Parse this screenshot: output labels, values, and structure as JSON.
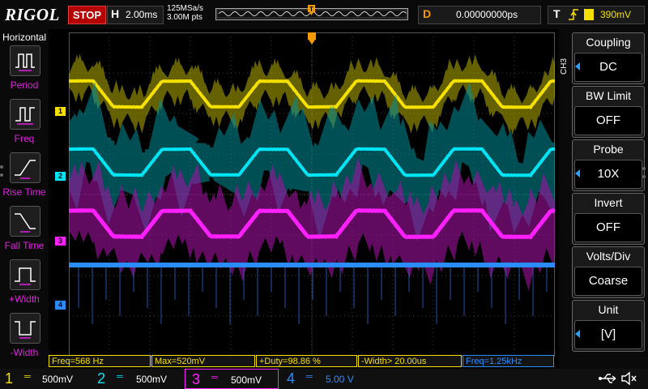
{
  "header": {
    "logo": "RIGOL",
    "run_state": "STOP",
    "h_letter": "H",
    "timebase": "2.00ms",
    "sample_rate": "125MSa/s",
    "memory_depth": "3.00M pts",
    "trigger_marker": "T",
    "delay_letter": "D",
    "delay": "0.00000000ps",
    "trigger_letter": "T",
    "trigger_edge_icon": "rising-edge-icon",
    "trigger_level": "390mV"
  },
  "horizontal_menu": {
    "title": "Horizontal",
    "items": [
      {
        "label": "Period",
        "icon": "period-icon"
      },
      {
        "label": "Freq",
        "icon": "frequency-icon"
      },
      {
        "label": "Rise Time",
        "icon": "rise-time-icon"
      },
      {
        "label": "Fall Time",
        "icon": "fall-time-icon"
      },
      {
        "label": "+Width",
        "icon": "positive-width-icon"
      },
      {
        "label": "-Width",
        "icon": "negative-width-icon"
      }
    ]
  },
  "channel_menu": {
    "channel_tag": "CH3",
    "items": [
      {
        "label": "Coupling",
        "value": "DC"
      },
      {
        "label": "BW Limit",
        "value": "OFF"
      },
      {
        "label": "Probe",
        "value": "10X"
      },
      {
        "label": "Invert",
        "value": "OFF"
      },
      {
        "label": "Volts/Div",
        "value": "Coarse"
      },
      {
        "label": "Unit",
        "value": "[V]"
      }
    ]
  },
  "waveform_markers": {
    "ch1": "1",
    "ch2": "2",
    "ch3": "3",
    "ch4": "4"
  },
  "measurements": [
    {
      "text": "Freq=568 Hz",
      "color": "#f5e000"
    },
    {
      "text": "Max=520mV",
      "color": "#f5e000"
    },
    {
      "text": "+Duty=98.86 %",
      "color": "#f5e000"
    },
    {
      "text": "-Width> 20.00us",
      "color": "#f5e000"
    },
    {
      "text": "Freq=1.25kHz",
      "color": "#2a8cff"
    }
  ],
  "channels": [
    {
      "number": "1",
      "coupling": "DC",
      "scale": "500mV",
      "color": "#f5e000"
    },
    {
      "number": "2",
      "coupling": "DC",
      "scale": "500mV",
      "color": "#00e5f5"
    },
    {
      "number": "3",
      "coupling": "DC",
      "scale": "500mV",
      "color": "#ff20ff"
    },
    {
      "number": "4",
      "coupling": "DC",
      "scale": "5.00 V",
      "color": "#2a8cff"
    }
  ],
  "status_icons": [
    "usb-icon",
    "speaker-icon"
  ],
  "colors": {
    "ch1": "#f5e000",
    "ch2": "#00e5f5",
    "ch3": "#ff20ff",
    "ch4": "#2a8cff",
    "stop": "#b40000",
    "delay": "#f59a00"
  }
}
